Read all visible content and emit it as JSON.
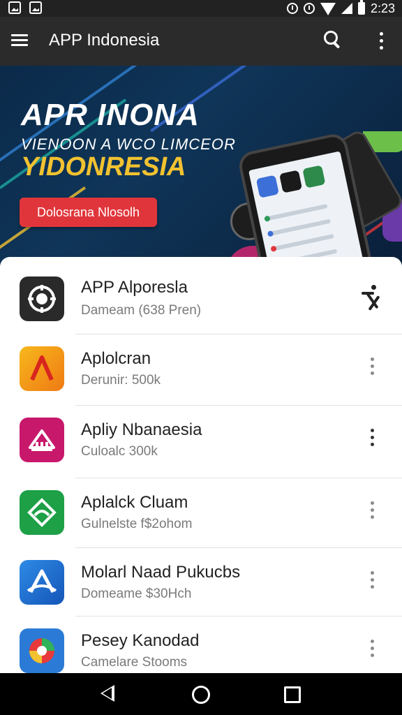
{
  "status_bar": {
    "time": "2:23",
    "icons": [
      "image-notification-icon",
      "image-notification-icon",
      "alarm-icon",
      "alarm-icon",
      "wifi-icon",
      "signal-icon",
      "battery-icon"
    ]
  },
  "app_bar": {
    "title": "APP Indonesia",
    "icons": [
      "menu-icon",
      "search-icon",
      "more-vert-icon"
    ]
  },
  "banner": {
    "title": "APR INONA",
    "subtitle": "VIENOON A WCO LIMCEOR",
    "highlight": "YIDONRESIA",
    "cta_label": "Dolosrana Nlosolh",
    "colors": {
      "background": "#0f3558",
      "accent": "#f2c230",
      "cta": "#e0363b"
    }
  },
  "apps": [
    {
      "name": "APP Alporesla",
      "subtitle": "Dameam (638 Pren)",
      "icon_color": "#2a2a2a",
      "icon": "compass-app-icon",
      "action_icon": "runner-icon"
    },
    {
      "name": "Aplolcran",
      "subtitle": "Derunir: 500k",
      "icon_color": "#f29a17",
      "icon": "letter-a-app-icon",
      "action_icon": "more-vert-icon"
    },
    {
      "name": "Apliy Nbanaesia",
      "subtitle": "Culoalc 300k",
      "icon_color": "#c8186b",
      "icon": "building-app-icon",
      "action_icon": "more-vert-icon"
    },
    {
      "name": "Aplalck Cluam",
      "subtitle": "Gulnelste f$2ohom",
      "icon_color": "#1da046",
      "icon": "diamond-app-icon",
      "action_icon": "more-vert-icon"
    },
    {
      "name": "Molarl Naad Pukucbs",
      "subtitle": "Domeame $30Hch",
      "icon_color": "#1f74d6",
      "icon": "letter-a-app-icon",
      "action_icon": "more-vert-icon"
    },
    {
      "name": "Pesey Kanodad",
      "subtitle": "Camelare Stooms",
      "icon_color": "#2b7bd6",
      "icon": "colorful-app-icon",
      "action_icon": "more-vert-icon"
    }
  ],
  "nav_bar": {
    "icons": [
      "back-icon",
      "home-icon",
      "recents-icon"
    ]
  }
}
